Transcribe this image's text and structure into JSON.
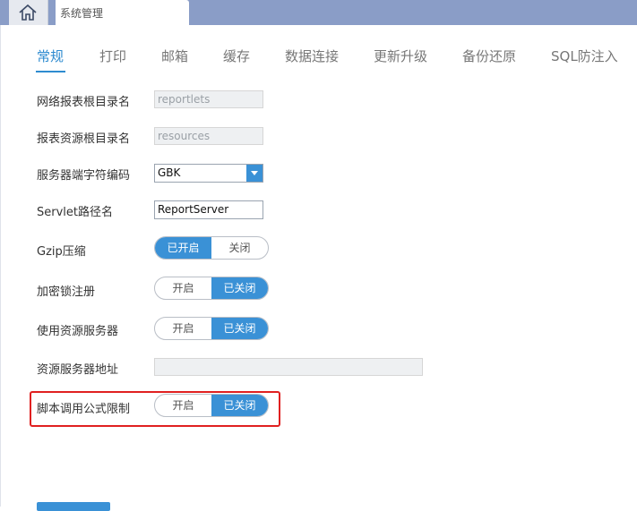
{
  "header": {
    "tab_label": "系统管理"
  },
  "nav_tabs": [
    {
      "label": "常规",
      "active": true
    },
    {
      "label": "打印",
      "active": false
    },
    {
      "label": "邮箱",
      "active": false
    },
    {
      "label": "缓存",
      "active": false
    },
    {
      "label": "数据连接",
      "active": false
    },
    {
      "label": "更新升级",
      "active": false
    },
    {
      "label": "备份还原",
      "active": false
    },
    {
      "label": "SQL防注入",
      "active": false
    }
  ],
  "settings": {
    "report_root": {
      "label": "网络报表根目录名",
      "value": "reportlets"
    },
    "resource_root": {
      "label": "报表资源根目录名",
      "value": "resources"
    },
    "encoding": {
      "label": "服务器端字符编码",
      "value": "GBK"
    },
    "servlet": {
      "label": "Servlet路径名",
      "value": "ReportServer"
    },
    "gzip": {
      "label": "Gzip压缩",
      "on_label": "已开启",
      "off_label": "关闭",
      "state": "on"
    },
    "lock": {
      "label": "加密锁注册",
      "on_label": "开启",
      "off_label": "已关闭",
      "state": "off"
    },
    "resource_server": {
      "label": "使用资源服务器",
      "on_label": "开启",
      "off_label": "已关闭",
      "state": "off"
    },
    "resource_server_addr": {
      "label": "资源服务器地址",
      "value": ""
    },
    "script_formula": {
      "label": "脚本调用公式限制",
      "on_label": "开启",
      "off_label": "已关闭",
      "state": "off"
    }
  },
  "icons": {
    "home": "home-icon",
    "dropdown": "chevron-down-icon"
  },
  "colors": {
    "accent": "#3a91d6",
    "topbar": "#8a9dc7",
    "highlight": "#e02020"
  }
}
